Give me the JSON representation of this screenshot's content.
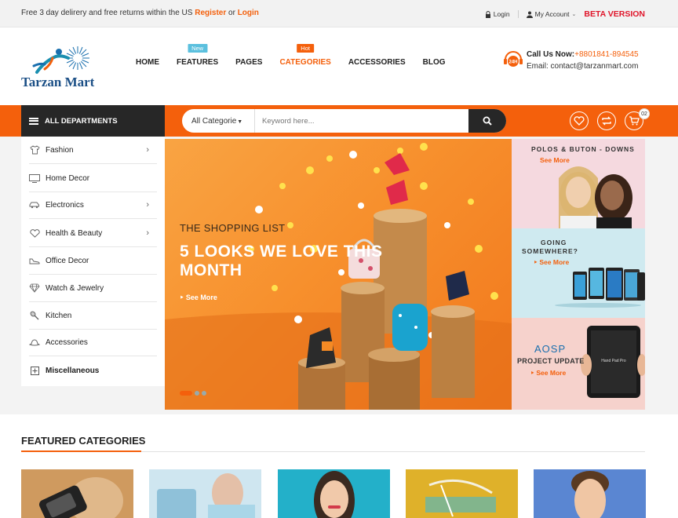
{
  "topbar": {
    "promo_prefix": "Free 3 day delirery and free returns within the US",
    "register": "Register",
    "or": "or",
    "login_link": "Login",
    "login": "Login",
    "account": "My Account",
    "beta": "BETA VERSION"
  },
  "logo": {
    "name": "Tarzan Mart"
  },
  "nav": [
    {
      "label": "HOME",
      "tag": ""
    },
    {
      "label": "FEATURES",
      "tag": "New"
    },
    {
      "label": "PAGES",
      "tag": ""
    },
    {
      "label": "CATEGORIES",
      "tag": "Hot"
    },
    {
      "label": "ACCESSORIES",
      "tag": ""
    },
    {
      "label": "BLOG",
      "tag": ""
    }
  ],
  "contact": {
    "call_label": "Call Us Now:",
    "phone": "+8801841-894545",
    "email": "Email: contact@tarzanmart.com",
    "badge": "24H"
  },
  "bar": {
    "departments": "ALL DEPARTMENTS",
    "category_select": "All Categorie",
    "search_placeholder": "Keyword here...",
    "cart_count": "02"
  },
  "sidebar": [
    {
      "label": "Fashion",
      "icon": "shirt-icon",
      "has_sub": true
    },
    {
      "label": "Home Decor",
      "icon": "tv-icon",
      "has_sub": false
    },
    {
      "label": "Electronics",
      "icon": "car-icon",
      "has_sub": true
    },
    {
      "label": "Health & Beauty",
      "icon": "heart-icon",
      "has_sub": true
    },
    {
      "label": "Office Decor",
      "icon": "shoe-icon",
      "has_sub": false
    },
    {
      "label": "Watch & Jewelry",
      "icon": "diamond-icon",
      "has_sub": false
    },
    {
      "label": "Kitchen",
      "icon": "spoon-icon",
      "has_sub": false
    },
    {
      "label": "Accessories",
      "icon": "hat-icon",
      "has_sub": false
    },
    {
      "label": "Miscellaneous",
      "icon": "plus-box-icon",
      "has_sub": false
    }
  ],
  "hero": {
    "subtitle": "THE SHOPPING LIST",
    "title": "5 LOOKS WE LOVE THIS MONTH",
    "see_more": "See More"
  },
  "promos": {
    "p1_title": "POLOS & BUTON - DOWNS",
    "p1_more": "See More",
    "p2_title_1": "GOING",
    "p2_title_2": "SOMEWHERE?",
    "p2_more": "See More",
    "p3_title_1": "AOSP",
    "p3_title_2": "PROJECT UPDATE",
    "p3_more": "See More",
    "p3_device": "Hand Pad Pro"
  },
  "featured": {
    "title": "FEATURED CATEGORIES"
  },
  "colors": {
    "accent": "#f4600c",
    "dark": "#272727",
    "beta": "#e0152a",
    "logo": "#1b4f86"
  }
}
